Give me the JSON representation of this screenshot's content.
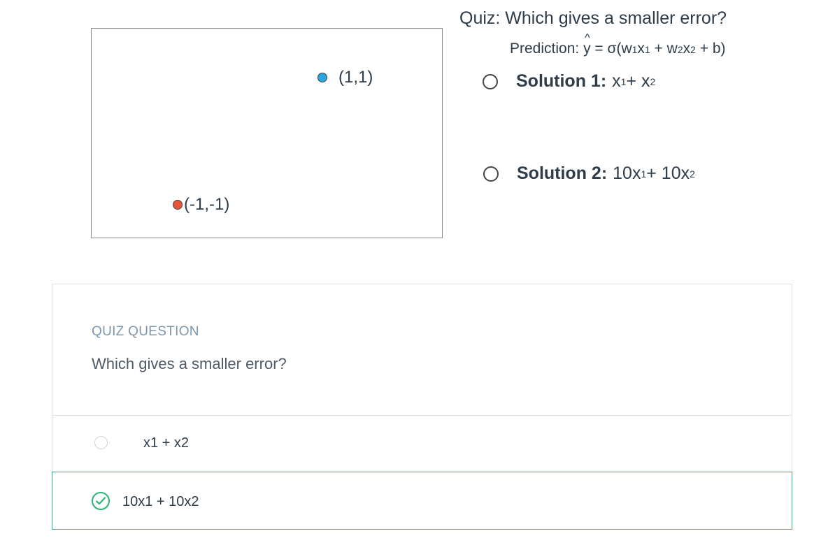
{
  "slide": {
    "points": [
      {
        "label": "(1,1)",
        "color": "#27a8e0"
      },
      {
        "label": "(-1,-1)",
        "color": "#e8563a"
      }
    ],
    "quiz_title": "Quiz: Which gives a smaller error?",
    "prediction": {
      "prefix": "Prediction: ",
      "yhat": "y",
      "hat": "^",
      "formula": " = σ(w",
      "w1_sub": "1",
      "x1": "x",
      "x1_sub": "1",
      "plus1": " + w",
      "w2_sub": "2",
      "x2": "x",
      "x2_sub": "2",
      "tail": " + b)"
    },
    "solutions": [
      {
        "label": "Solution 1:",
        "expr_a": "x",
        "sub_a": "1",
        "plus": " + x",
        "sub_b": "2"
      },
      {
        "label": "Solution 2:",
        "expr_a": "10x",
        "sub_a": "1",
        "plus": " + 10x",
        "sub_b": "2"
      }
    ]
  },
  "quiz": {
    "label": "QUIZ QUESTION",
    "question": "Which gives a smaller error?",
    "options": [
      {
        "text": "x1 + x2",
        "selected": false
      },
      {
        "text": "10x1 + 10x2",
        "selected": true,
        "status": "correct"
      }
    ],
    "accent_color": "#2bb573"
  }
}
